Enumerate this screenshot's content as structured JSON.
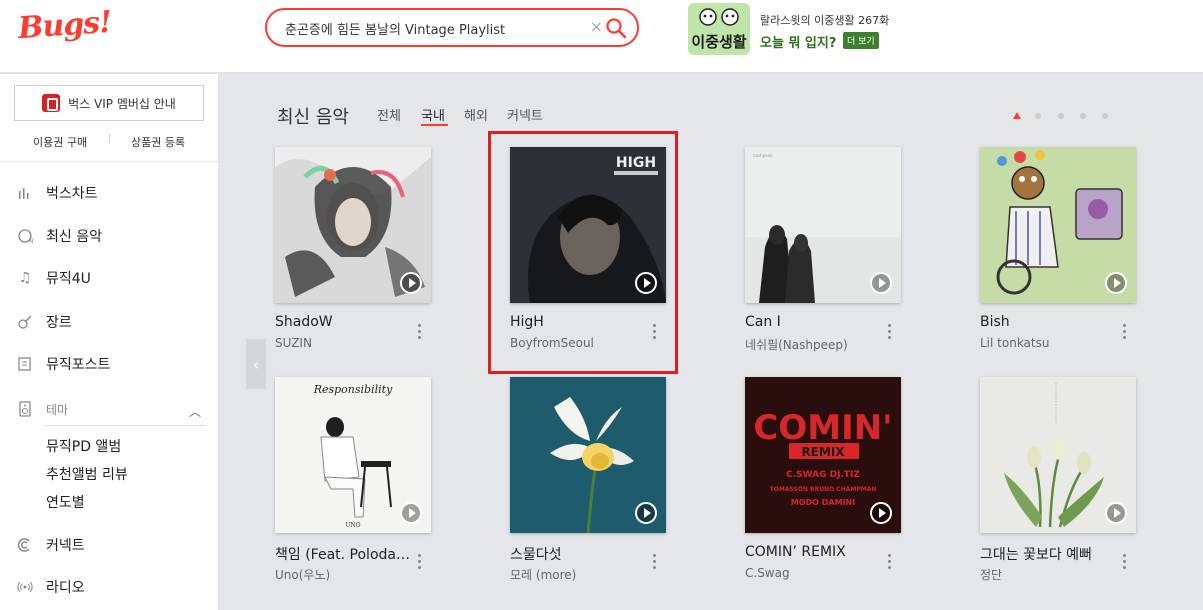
{
  "header": {
    "logo": "Bugs!",
    "search": {
      "placeholder": "춘곤증에 힘든 봄날의 Vintage Playlist",
      "clear": "×"
    },
    "promo": {
      "logo_text": "이중생활",
      "subtitle": "랄라스윗의 이중생활 267화",
      "title": "오늘 뭐 입지?",
      "more": "더 보기"
    }
  },
  "sidebar": {
    "vip_button": "벅스 VIP 멤버십 안내",
    "links": [
      "이용권 구매",
      "상품권 등록"
    ],
    "nav": [
      {
        "label": "벅스차트",
        "icon": "chart-icon"
      },
      {
        "label": "최신 음악",
        "icon": "new-music-icon"
      },
      {
        "label": "뮤직4U",
        "icon": "music-note-icon"
      },
      {
        "label": "장르",
        "icon": "guitar-icon"
      },
      {
        "label": "뮤직포스트",
        "icon": "post-icon"
      }
    ],
    "theme": {
      "label": "테마",
      "icon": "speaker-icon",
      "items": [
        "뮤직PD 앨범",
        "추천앨범 리뷰",
        "연도별"
      ]
    },
    "nav_bottom": [
      {
        "label": "커넥트",
        "icon": "connect-icon"
      },
      {
        "label": "라디오",
        "icon": "radio-icon"
      }
    ]
  },
  "main": {
    "section_title": "최신 음악",
    "tabs": [
      "전체",
      "국내",
      "해외",
      "커넥트"
    ],
    "active_tab": "국내",
    "pagination": {
      "pages": 5,
      "current": 1
    },
    "albums": [
      {
        "title": "ShadoW",
        "artist": "SUZIN"
      },
      {
        "title": "HigH",
        "artist": "BoyfromSeoul",
        "cover_text": "HIGH",
        "highlighted": true
      },
      {
        "title": "Can I",
        "artist": "네쉬필(Nashpeep)"
      },
      {
        "title": "Bish",
        "artist": "Lil tonkatsu"
      },
      {
        "title": "책임 (Feat. Polodare…",
        "artist": "Uno(우노)",
        "cover_text": "Responsibility"
      },
      {
        "title": "스물다섯",
        "artist": "모레 (more)"
      },
      {
        "title": "COMIN’ REMIX",
        "artist": "C.Swag",
        "cover_text": "COMIN'"
      },
      {
        "title": "그대는 꽃보다 예뻐",
        "artist": "정단"
      }
    ]
  },
  "colors": {
    "accent": "#ff3a2f",
    "highlight": "#e01e1e",
    "promo_green": "#3d7f2c"
  }
}
